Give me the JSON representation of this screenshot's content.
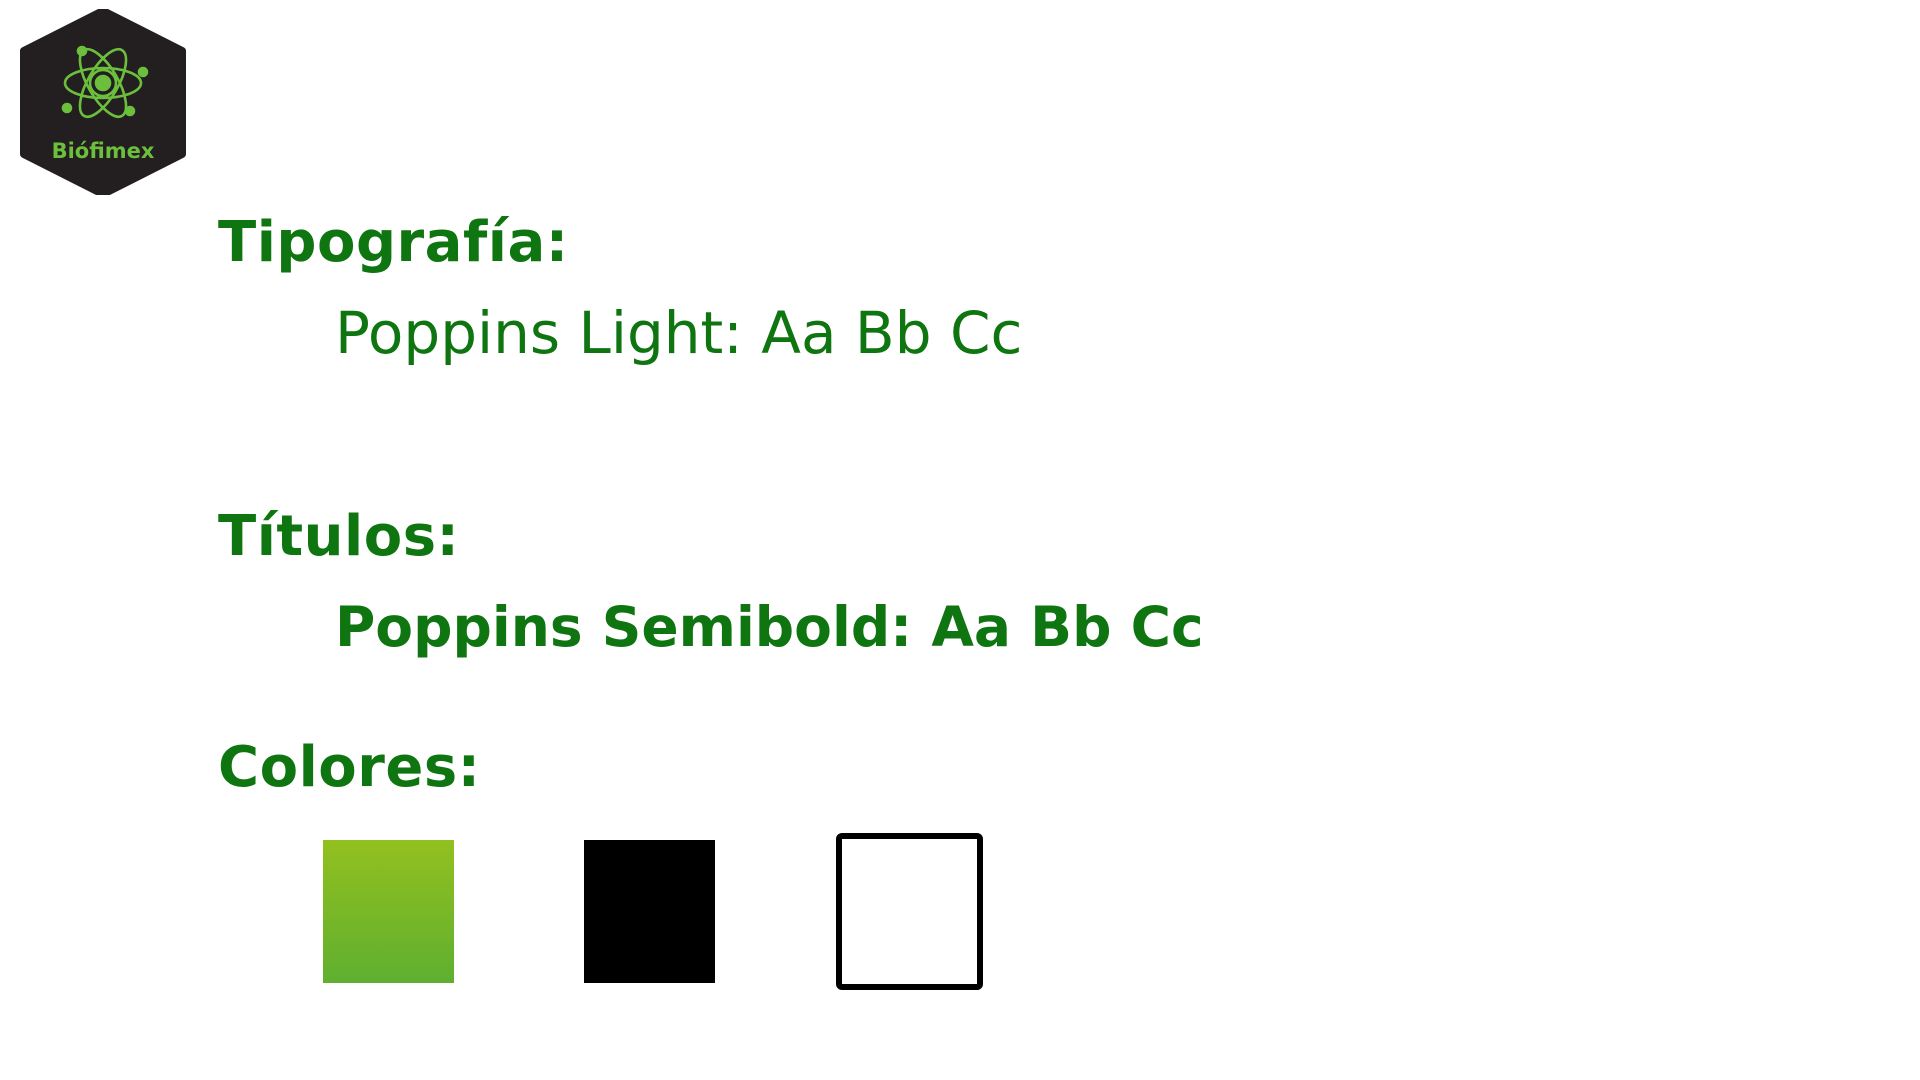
{
  "brand": {
    "name": "Biófimex",
    "hex_fill": "#231f20",
    "accent": "#6cbf3c"
  },
  "theme": {
    "text_green": "#0f7510"
  },
  "typography": {
    "heading": "Tipografía:",
    "sample": "Poppins Light: Aa Bb Cc"
  },
  "titles": {
    "heading": "Títulos:",
    "sample": "Poppins Semibold: Aa Bb Cc"
  },
  "colors": {
    "heading": "Colores:",
    "swatches": [
      {
        "name": "green",
        "top": "#93c01f",
        "bottom": "#5faf30"
      },
      {
        "name": "black",
        "fill": "#000000"
      },
      {
        "name": "white",
        "fill": "#ffffff",
        "border": "#000000"
      }
    ]
  }
}
